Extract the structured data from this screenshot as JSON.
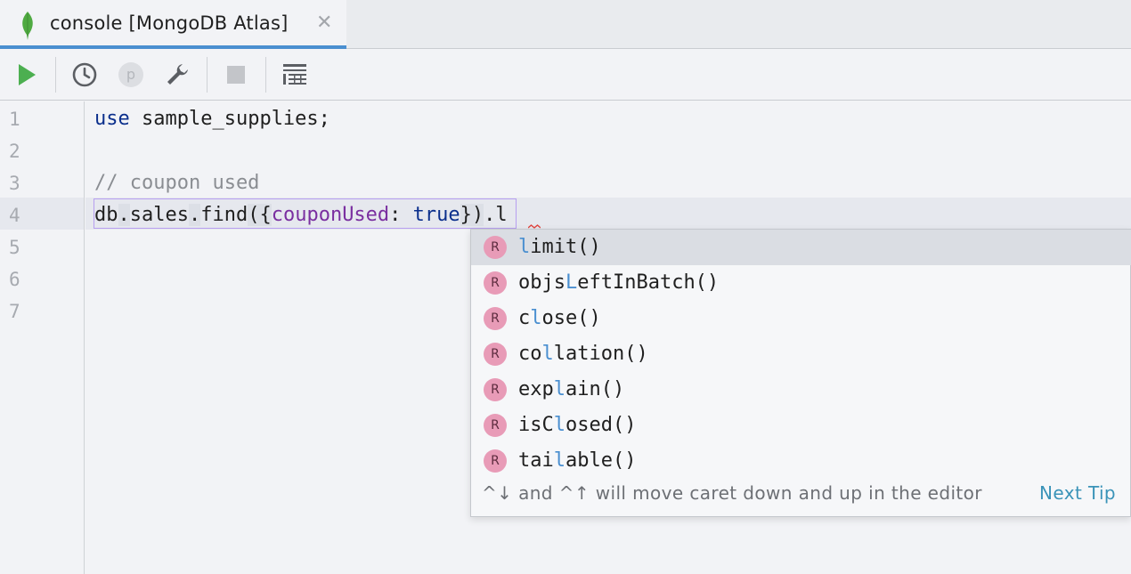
{
  "tab": {
    "title": "console [MongoDB Atlas]",
    "close_glyph": "✕",
    "icon": "mongodb-leaf-icon"
  },
  "toolbar": {
    "buttons": [
      {
        "name": "run-button",
        "icon": "play-icon"
      },
      {
        "name": "history-button",
        "icon": "clock-icon"
      },
      {
        "name": "parameters-button",
        "icon": "p-icon",
        "label": "p"
      },
      {
        "name": "settings-button",
        "icon": "wrench-icon"
      },
      {
        "name": "stop-button",
        "icon": "stop-icon"
      },
      {
        "name": "output-button",
        "icon": "table-icon"
      }
    ]
  },
  "editor": {
    "line_numbers": [
      "1",
      "2",
      "3",
      "4",
      "5",
      "6",
      "7"
    ],
    "lines": {
      "l1_kw": "use",
      "l1_rest": " sample_supplies;",
      "l3": "// coupon used",
      "l4_a": "db",
      "l4_b": ".",
      "l4_c": "sales",
      "l4_d": ".",
      "l4_e": "find",
      "l4_f": "({",
      "l4_g": "couponUsed",
      "l4_h": ": ",
      "l4_i": "true",
      "l4_j": "})",
      "l4_k": ".",
      "l4_l": "l"
    }
  },
  "completion": {
    "badge": "R",
    "items": [
      {
        "pre": "",
        "match": "l",
        "post": "imit()"
      },
      {
        "pre": "objs",
        "match": "L",
        "post": "eftInBatch()"
      },
      {
        "pre": "c",
        "match": "l",
        "post": "ose()"
      },
      {
        "pre": "co",
        "match": "l",
        "post": "lation()"
      },
      {
        "pre": "exp",
        "match": "l",
        "post": "ain()"
      },
      {
        "pre": "isC",
        "match": "l",
        "post": "osed()"
      },
      {
        "pre": "tai",
        "match": "l",
        "post": "able()"
      }
    ],
    "tip": "^↓ and ^↑ will move caret down and up in the editor",
    "tip_link": "Next Tip"
  },
  "colors": {
    "accent": "#4a8fd0",
    "badge": "#e89bb7",
    "link": "#3a93b8",
    "run": "#4caf50"
  }
}
